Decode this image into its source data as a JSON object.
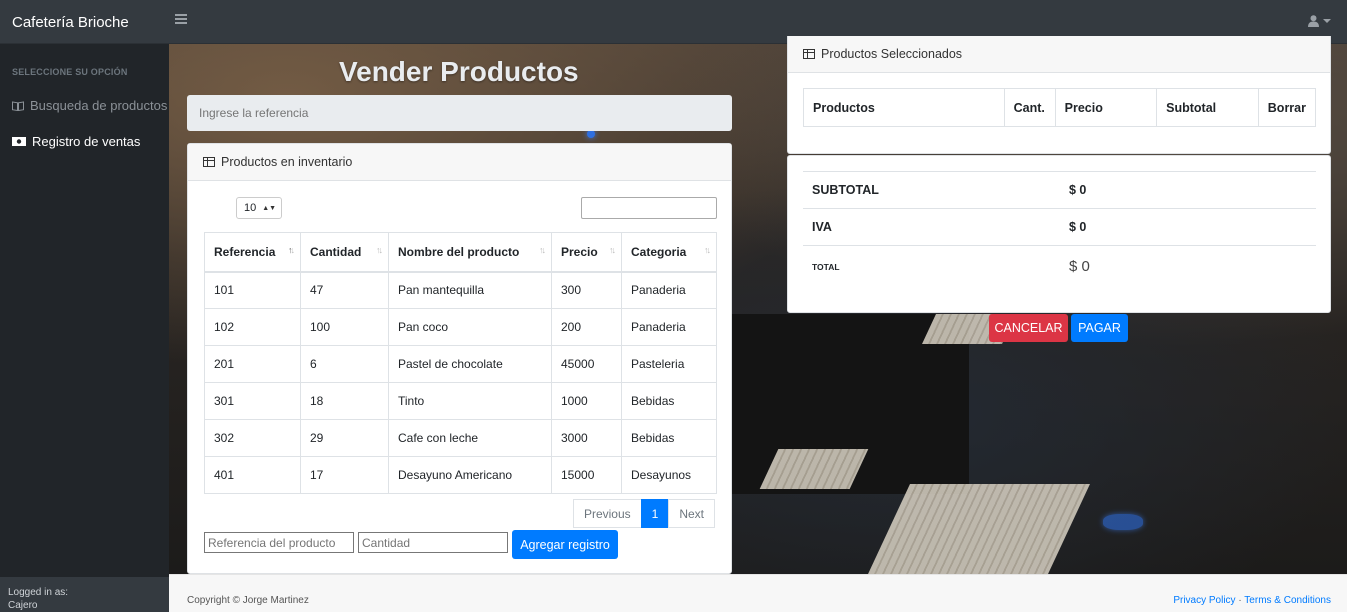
{
  "app": {
    "brand": "Cafetería Brioche"
  },
  "sidebar": {
    "heading": "SELECCIONE SU OPCIÓN",
    "items": [
      {
        "label": "Busqueda de productos",
        "icon": "book-icon"
      },
      {
        "label": "Registro de ventas",
        "icon": "money-bill-icon"
      }
    ],
    "footer": {
      "logged_in_label": "Logged in as:",
      "user": "Cajero"
    }
  },
  "main": {
    "title": "Vender Productos",
    "search_placeholder": "Ingrese la referencia"
  },
  "inventory": {
    "header": "Productos en inventario",
    "page_length": "10",
    "columns": [
      "Referencia",
      "Cantidad",
      "Nombre del producto",
      "Precio",
      "Categoria"
    ],
    "rows": [
      [
        "101",
        "47",
        "Pan mantequilla",
        "300",
        "Panaderia"
      ],
      [
        "102",
        "100",
        "Pan coco",
        "200",
        "Panaderia"
      ],
      [
        "201",
        "6",
        "Pastel de chocolate",
        "45000",
        "Pasteleria"
      ],
      [
        "301",
        "18",
        "Tinto",
        "1000",
        "Bebidas"
      ],
      [
        "302",
        "29",
        "Cafe con leche",
        "3000",
        "Bebidas"
      ],
      [
        "401",
        "17",
        "Desayuno Americano",
        "15000",
        "Desayunos"
      ]
    ],
    "pagination": {
      "previous": "Previous",
      "current": "1",
      "next": "Next"
    },
    "ref_placeholder": "Referencia del producto",
    "qty_placeholder": "Cantidad",
    "add_button": "Agregar registro"
  },
  "selected": {
    "header": "Productos Seleccionados",
    "columns": [
      "Productos",
      "Cant.",
      "Precio",
      "Subtotal",
      "Borrar"
    ]
  },
  "totals": {
    "subtotal_label": "SUBTOTAL",
    "subtotal_value": "$ 0",
    "iva_label": "IVA",
    "iva_value": "$ 0",
    "total_label": "TOTAL",
    "total_value": "$ 0"
  },
  "actions": {
    "cancel": "CANCELAR",
    "pay": "PAGAR"
  },
  "footer": {
    "copyright": "Copyright © Jorge Martinez",
    "privacy": "Privacy Policy",
    "separator": "·",
    "terms": "Terms & Conditions"
  },
  "colors": {
    "primary": "#007bff",
    "danger": "#dc3545",
    "sidebar": "#212529",
    "navbar": "#343a40"
  }
}
